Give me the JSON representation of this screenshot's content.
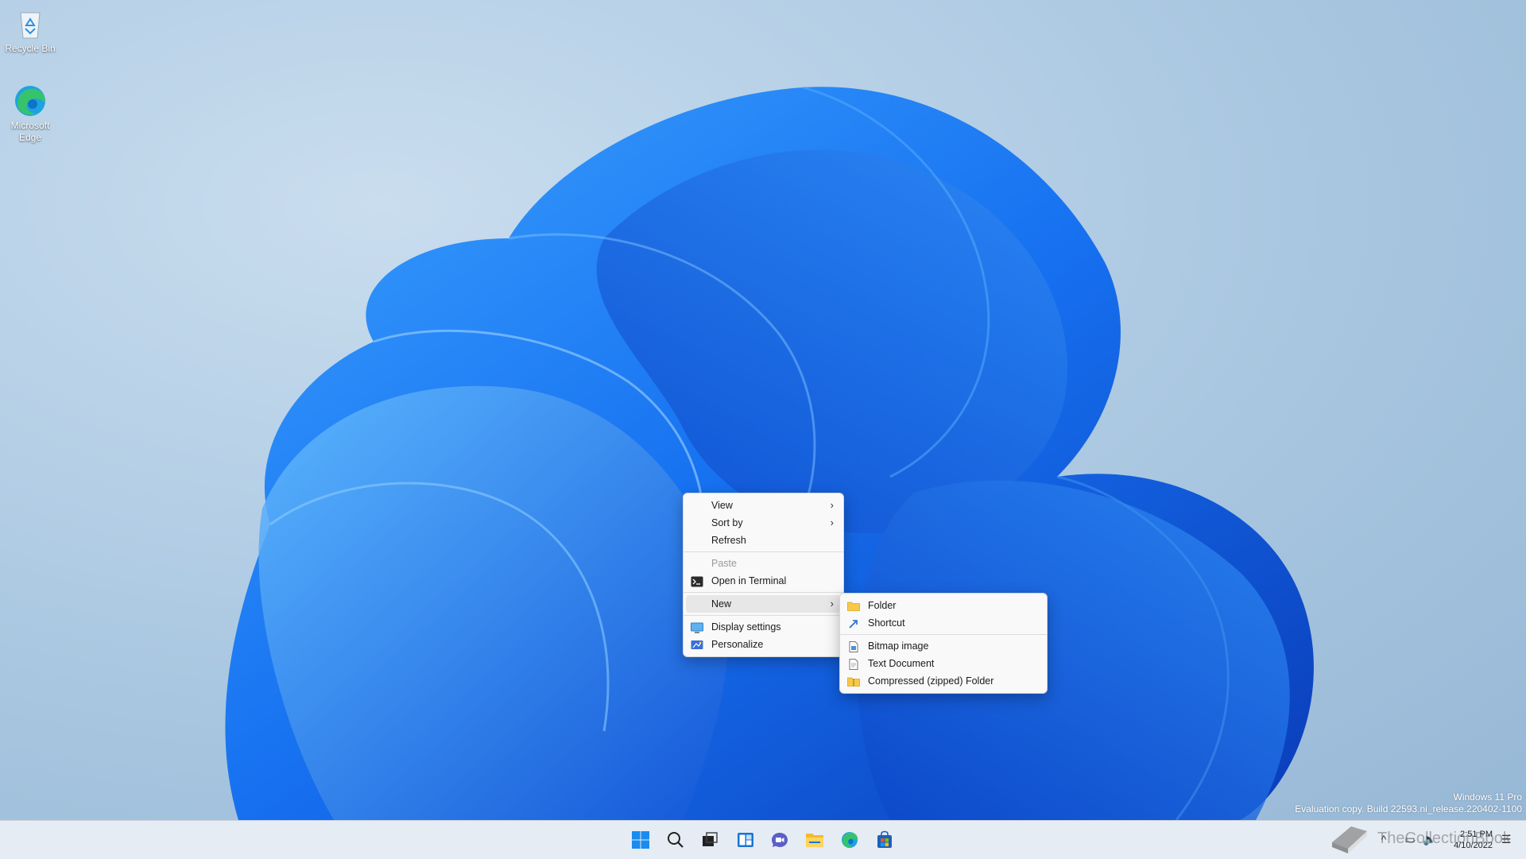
{
  "desktop_icons": [
    {
      "label": "Recycle Bin",
      "icon": "recycle-bin-icon"
    },
    {
      "label": "Microsoft Edge",
      "icon": "edge-icon"
    }
  ],
  "context_menu": {
    "items": [
      {
        "label": "View",
        "submenu_arrow": "›"
      },
      {
        "label": "Sort by",
        "submenu_arrow": "›"
      },
      {
        "label": "Refresh"
      },
      {
        "label": "Paste",
        "disabled": true
      },
      {
        "label": "Open in Terminal",
        "icon": "terminal-icon"
      },
      {
        "label": "New",
        "submenu_arrow": "›",
        "highlighted": true
      },
      {
        "label": "Display settings",
        "icon": "display-icon"
      },
      {
        "label": "Personalize",
        "icon": "personalize-icon"
      }
    ]
  },
  "new_submenu": {
    "items": [
      {
        "label": "Folder",
        "icon": "folder-icon"
      },
      {
        "label": "Shortcut",
        "icon": "shortcut-icon"
      },
      {
        "label": "Bitmap image",
        "icon": "bitmap-icon"
      },
      {
        "label": "Text Document",
        "icon": "text-document-icon"
      },
      {
        "label": "Compressed (zipped) Folder",
        "icon": "zip-folder-icon"
      }
    ]
  },
  "watermark": {
    "line1": "Windows 11 Pro",
    "line2": "Evaluation copy. Build 22593.ni_release.220402-1100"
  },
  "taskbar": {
    "apps": [
      "start-icon",
      "search-icon",
      "task-view-icon",
      "widgets-icon",
      "chat-icon",
      "file-explorer-icon",
      "edge-icon",
      "store-icon"
    ],
    "time": "2:51 PM",
    "date": "4/10/2022",
    "site_watermark": "TheCollectionBook"
  },
  "colors": {
    "taskbar_bg": "#e6ecf4",
    "menu_bg": "#f9f9f9",
    "accent": "#0067c0"
  }
}
